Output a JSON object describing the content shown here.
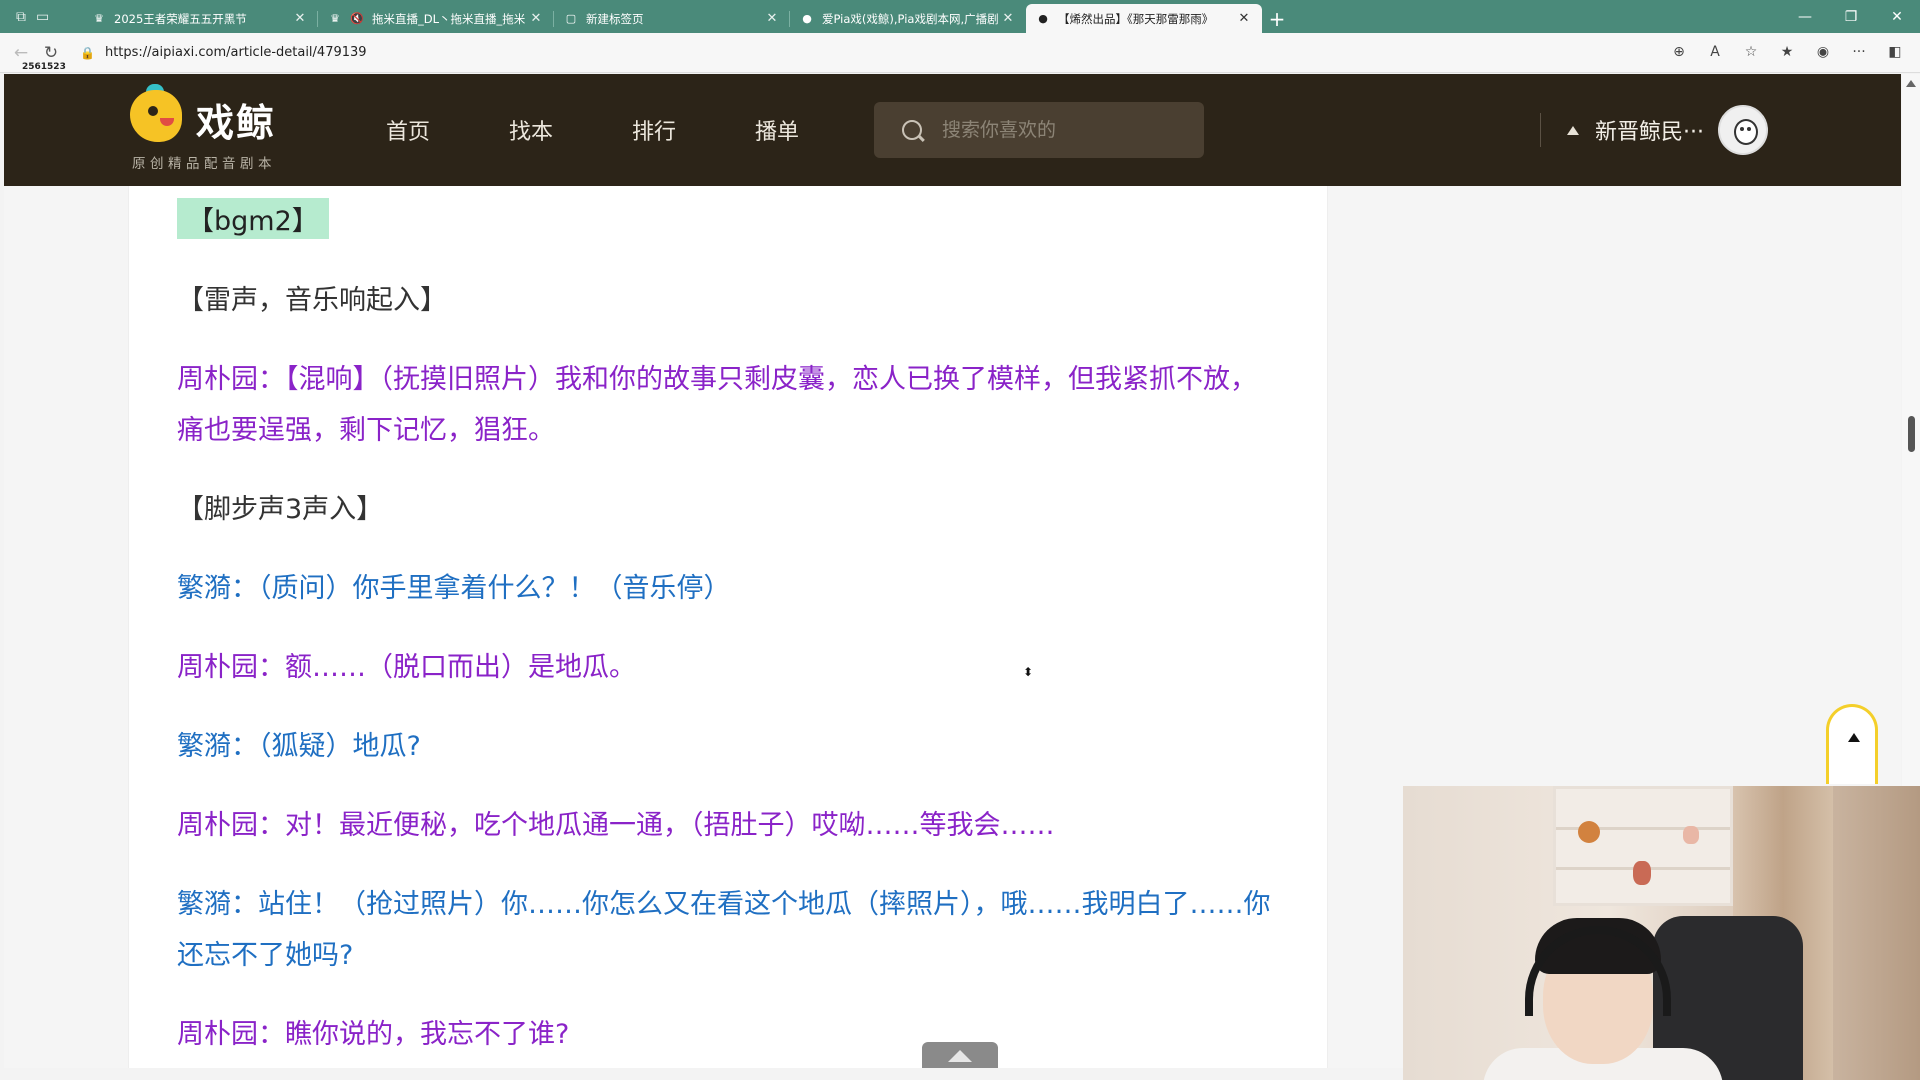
{
  "browser": {
    "tabs": [
      {
        "title": "2025王者荣耀五五开黑节",
        "active": false
      },
      {
        "title": "拖米直播_DL丶拖米直播_拖米",
        "active": false,
        "muted": true
      },
      {
        "title": "新建标签页",
        "active": false
      },
      {
        "title": "爱Pia戏(戏鲸),Pia戏剧本网,广播剧",
        "active": false
      },
      {
        "title": "【烯然出品】《那天那雷那雨》",
        "active": true
      }
    ],
    "url": "https://aipiaxi.com/article-detail/479139",
    "badge": "2561523"
  },
  "site": {
    "logo_name": "戏鲸",
    "logo_slogan": "原创精品配音剧本",
    "nav": [
      "首页",
      "找本",
      "排行",
      "播单"
    ],
    "search_placeholder": "搜索你喜欢的",
    "username": "新晋鲸民···"
  },
  "script": {
    "bgm_tag": "【bgm2】",
    "lines": [
      {
        "type": "sfx",
        "text": "【雷声，音乐响起入】"
      },
      {
        "type": "zhou",
        "text": "周朴园：【混响】（抚摸旧照片）我和你的故事只剩皮囊，恋人已换了模样，但我紧抓不放，痛也要逞强，剩下记忆，猖狂。"
      },
      {
        "type": "sfx",
        "text": "【脚步声3声入】"
      },
      {
        "type": "fan",
        "text": "繁漪：（质问）你手里拿着什么？！（音乐停）"
      },
      {
        "type": "zhou",
        "text": "周朴园：额……（脱口而出）是地瓜。"
      },
      {
        "type": "fan",
        "text": "繁漪：（狐疑）地瓜?"
      },
      {
        "type": "zhou",
        "text": "周朴园：对！最近便秘，吃个地瓜通一通，（捂肚子）哎呦……等我会……"
      },
      {
        "type": "fan",
        "text": "繁漪：站住！（抢过照片）你……你怎么又在看这个地瓜（摔照片），哦……我明白了……你还忘不了她吗?"
      },
      {
        "type": "zhou",
        "text": "周朴园：瞧你说的，我忘不了谁?"
      }
    ]
  },
  "colors": {
    "header_bg": "#2c2418",
    "zhou_color": "#8a23c8",
    "fan_color": "#1f6fc2",
    "bgm_highlight": "#b6ebcf",
    "backtop_border": "#f4cf2a",
    "tab_strip": "#4a8a7a"
  }
}
